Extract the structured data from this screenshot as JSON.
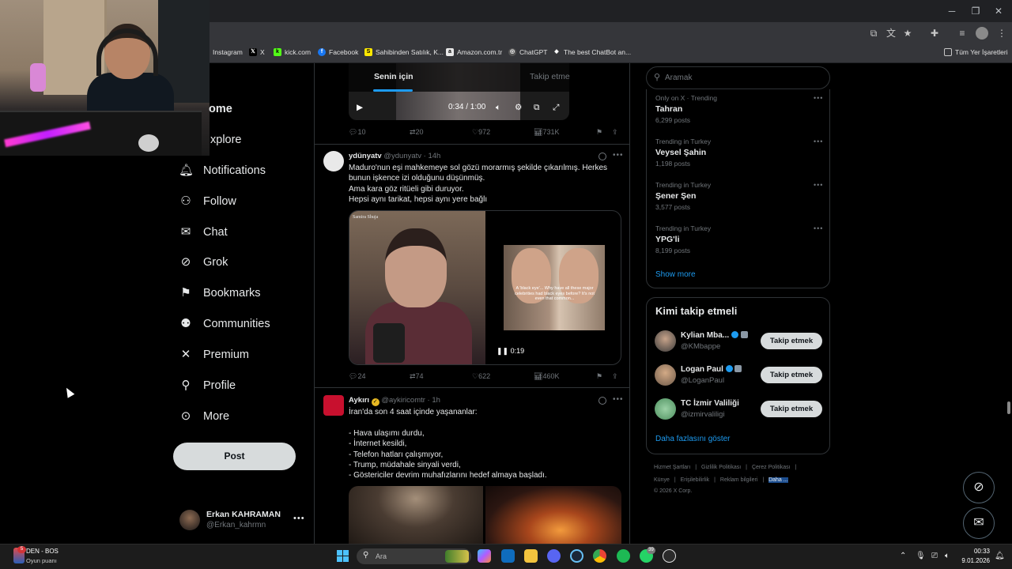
{
  "browser": {
    "bookmarks": [
      {
        "label": "Instagram",
        "icon": "instagram-icon"
      },
      {
        "label": "X",
        "icon": "x-logo-icon"
      },
      {
        "label": "kick.com",
        "icon": "kick-icon"
      },
      {
        "label": "Facebook",
        "icon": "facebook-icon"
      },
      {
        "label": "Sahibinden Satılık, K...",
        "icon": "sahibinden-icon"
      },
      {
        "label": "Amazon.com.tr",
        "icon": "amazon-icon"
      },
      {
        "label": "ChatGPT",
        "icon": "chatgpt-icon"
      },
      {
        "label": "The best ChatBot an...",
        "icon": "chatbot-icon"
      }
    ],
    "all_bookmarks": "Tüm Yer İşaretleri"
  },
  "nav": {
    "home_partial": "ome",
    "explore_partial": "xplore",
    "items": [
      {
        "label": "Notifications",
        "icon": "bell-icon"
      },
      {
        "label": "Follow",
        "icon": "add-person-icon"
      },
      {
        "label": "Chat",
        "icon": "mail-icon"
      },
      {
        "label": "Grok",
        "icon": "grok-icon"
      },
      {
        "label": "Bookmarks",
        "icon": "bookmark-icon"
      },
      {
        "label": "Communities",
        "icon": "communities-icon"
      },
      {
        "label": "Premium",
        "icon": "x-logo-icon"
      },
      {
        "label": "Profile",
        "icon": "person-icon"
      },
      {
        "label": "More",
        "icon": "more-circle-icon"
      }
    ],
    "post_label": "Post",
    "account": {
      "name": "Erkan KAHRAMAN",
      "handle": "@Erkan_kahrmn"
    }
  },
  "timeline": {
    "tabs": [
      "Senin için",
      "Takip etme"
    ],
    "video_time": "0:34 / 1:00",
    "top_actions": {
      "replies": "10",
      "reposts": "20",
      "likes": "972",
      "views": "731K"
    },
    "tweets": [
      {
        "name": "ydünyatv",
        "handle": "@ydunyatv",
        "time": "· 14h",
        "lines": [
          "Maduro'nun eşi mahkemeye sol gözü morarmış şekilde çıkarılmış. Herkes",
          "bunun işkence izi olduğunu düşünmüş.",
          "Ama kara göz ritüeli gibi duruyor.",
          "Hepsi aynı tarikat, hepsi aynı yere bağlı"
        ],
        "media_label": "Samira Shuja",
        "media_caption": "A 'black eye'... Why have all these major celebrities had black eyes before? It's not even that common...",
        "duration": "0:19",
        "actions": {
          "replies": "24",
          "reposts": "74",
          "likes": "622",
          "views": "460K"
        }
      },
      {
        "name": "Aykırı",
        "handle": "@aykiricomtr",
        "time": "· 1h",
        "lines": [
          "İran'da son 4 saat içinde yaşananlar:",
          "",
          "- Hava ulaşımı durdu,",
          "- İnternet kesildi,",
          "- Telefon hatları çalışmıyor,",
          "- Trump, müdahale sinyali verdi,",
          "- Göstericiler devrim muhafızlarını hedef almaya başladı."
        ]
      }
    ]
  },
  "sidebar": {
    "search_placeholder": "Aramak",
    "trends": [
      {
        "context": "Only on X · Trending",
        "title": "Tahran",
        "count": "6,299 posts"
      },
      {
        "context": "Trending in Turkey",
        "title": "Veysel Şahin",
        "count": "1,198 posts"
      },
      {
        "context": "Trending in Turkey",
        "title": "Şener Şen",
        "count": "3,577 posts"
      },
      {
        "context": "Trending in Turkey",
        "title": "YPG'li",
        "count": "8,199 posts"
      }
    ],
    "show_more": "Show more",
    "who_to_follow": {
      "title": "Kimi takip etmeli",
      "button": "Takip etmek",
      "users": [
        {
          "name": "Kylian Mba...",
          "handle": "@KMbappe"
        },
        {
          "name": "Logan Paul",
          "handle": "@LoganPaul"
        },
        {
          "name": "TC İzmir Valiliği",
          "handle": "@izmirvaliligi"
        }
      ],
      "more": "Daha fazlasını göster"
    },
    "footer": {
      "row1": [
        "Hizmet Şartları",
        "|",
        "Gizlilik Politikası",
        "|",
        "Çerez Politikası",
        "|"
      ],
      "row2": [
        "Künye",
        "|",
        "Erişilebilirlik",
        "|",
        "Reklam bilgileri",
        "|",
        "Daha ..."
      ],
      "copyright": "© 2026 X Corp."
    }
  },
  "taskbar": {
    "score_line1": "DEN - BOS",
    "score_line2": "Oyun puanı",
    "widget_badge": "5",
    "search_placeholder": "Ara",
    "whatsapp_badge": "39",
    "time": "00:33",
    "date": "9.01.2026"
  },
  "colors": {
    "accent": "#1d9bf0",
    "background": "#000000",
    "border": "#2f3336",
    "muted": "#71767b"
  }
}
